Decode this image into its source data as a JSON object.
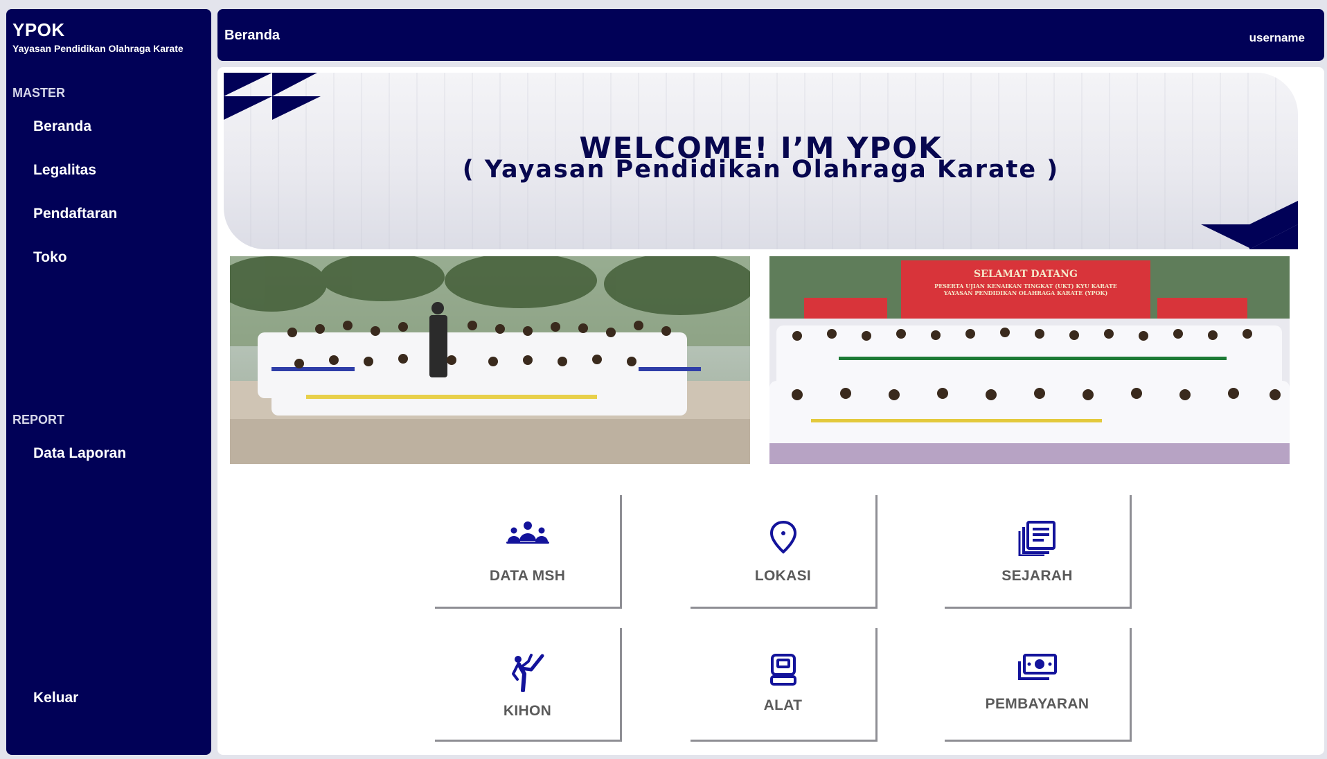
{
  "sidebar": {
    "title": "YPOK",
    "subtitle": "Yayasan Pendidikan Olahraga Karate",
    "sections": [
      {
        "label": "MASTER",
        "items": [
          {
            "label": "Beranda"
          },
          {
            "label": "Legalitas"
          },
          {
            "label": "Pendaftaran"
          },
          {
            "label": "Toko"
          }
        ]
      },
      {
        "label": "REPORT",
        "items": [
          {
            "label": "Data Laporan"
          }
        ]
      }
    ],
    "logout_label": "Keluar"
  },
  "header": {
    "title": "Beranda",
    "user": "username"
  },
  "banner": {
    "line1": "WELCOME! I’M YPOK",
    "line2": "( Yayasan Pendidikan Olahraga Karate )"
  },
  "photos": [
    {
      "icon": "group-photo-outdoor"
    },
    {
      "icon": "group-photo-event",
      "sign_line1": "SELAMAT DATANG",
      "sign_line2": "PESERTA UJIAN KENAIKAN TINGKAT (UKT) KYU KARATE",
      "sign_line3": "YAYASAN PENDIDIKAN OLAHRAGA KARATE (YPOK)"
    }
  ],
  "menu": [
    {
      "label": "DATA MSH",
      "icon": "people-group-icon"
    },
    {
      "label": "LOKASI",
      "icon": "location-pin-icon"
    },
    {
      "label": "SEJARAH",
      "icon": "document-stack-icon"
    },
    {
      "label": "KIHON",
      "icon": "karate-kick-icon"
    },
    {
      "label": "ALAT",
      "icon": "equipment-icon"
    },
    {
      "label": "PEMBAYARAN",
      "icon": "money-icon"
    }
  ],
  "colors": {
    "navy": "#010157",
    "icon_blue": "#13139b",
    "card_text": "#5a5a5a"
  }
}
